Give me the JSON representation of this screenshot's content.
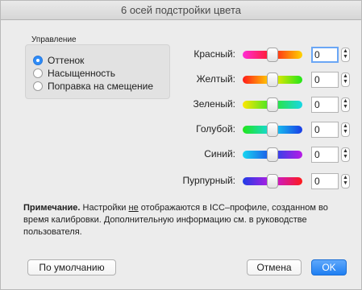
{
  "window": {
    "title": "6 осей подстройки цвета"
  },
  "control": {
    "group_label": "Управление",
    "options": [
      {
        "label": "Оттенок",
        "selected": true
      },
      {
        "label": "Насыщенность",
        "selected": false
      },
      {
        "label": "Поправка на смещение",
        "selected": false
      }
    ]
  },
  "axes": [
    {
      "label": "Красный:",
      "value": "0",
      "slider_position": 0.5,
      "gradient": [
        "#ff2bd6",
        "#ff1a1a",
        "#ffd400"
      ]
    },
    {
      "label": "Желтый:",
      "value": "0",
      "slider_position": 0.5,
      "gradient": [
        "#ff1a1a",
        "#ffe600",
        "#22e61a"
      ]
    },
    {
      "label": "Зеленый:",
      "value": "0",
      "slider_position": 0.5,
      "gradient": [
        "#ffe600",
        "#2ee62a",
        "#17d7e6"
      ]
    },
    {
      "label": "Голубой:",
      "value": "0",
      "slider_position": 0.5,
      "gradient": [
        "#22e61a",
        "#16d6f0",
        "#1a3ce6"
      ]
    },
    {
      "label": "Синий:",
      "value": "0",
      "slider_position": 0.5,
      "gradient": [
        "#16d6f0",
        "#1f4ae8",
        "#b81ae6"
      ]
    },
    {
      "label": "Пурпурный:",
      "value": "0",
      "slider_position": 0.5,
      "gradient": [
        "#1f3ce6",
        "#c21ae0",
        "#ff1a1a"
      ]
    }
  ],
  "note": {
    "bold": "Примечание.",
    "part1": " Настройки ",
    "underlined": "не",
    "part2": " отображаются в ICC–профиле, созданном во время калибровки. Дополнительную информацию см. в руководстве пользователя."
  },
  "buttons": {
    "default_label": "По умолчанию",
    "cancel_label": "Отмена",
    "ok_label": "OK"
  },
  "stepper_glyphs": {
    "up": "▲",
    "down": "▼"
  }
}
